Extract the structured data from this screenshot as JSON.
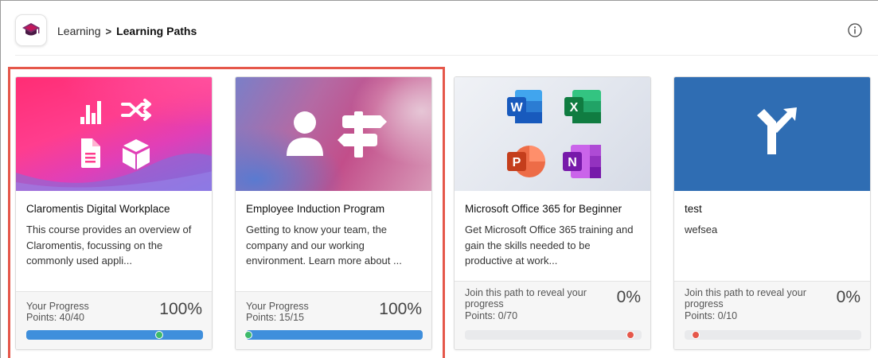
{
  "header": {
    "breadcrumb_root": "Learning",
    "breadcrumb_separator": ">",
    "breadcrumb_current": "Learning Paths",
    "info_icon": "info-icon",
    "logo_icon": "graduation-cap-icon"
  },
  "colors": {
    "accent": "#3f8fdc",
    "highlight_border": "#e5574a",
    "progress_dot_complete": "#3dba6a",
    "progress_dot_none": "#e5574a"
  },
  "cards": [
    {
      "title": "Claromentis Digital Workplace",
      "description": "This course provides an overview of Claromentis, focussing on the commonly used appli...",
      "progress_label": "Your Progress",
      "points": "Points: 40/40",
      "percent": "100%",
      "progress_fraction": 1.0,
      "icons": [
        "bar-chart-icon",
        "shuffle-icon",
        "document-icon",
        "cube-icon"
      ]
    },
    {
      "title": "Employee Induction Program",
      "description": "Getting to know your team, the company and our working environment. Learn more about ...",
      "progress_label": "Your Progress",
      "points": "Points: 15/15",
      "percent": "100%",
      "progress_fraction": 1.0,
      "icons": [
        "person-icon",
        "signpost-icon"
      ]
    },
    {
      "title": "Microsoft Office 365 for Beginner",
      "description": "Get Microsoft Office 365 training and gain the skills needed to be productive at work...",
      "progress_label": "Join this path to reveal your progress",
      "points": "Points: 0/70",
      "percent": "0%",
      "progress_fraction": 0.0,
      "icons": [
        "word-icon",
        "excel-icon",
        "powerpoint-icon",
        "onenote-icon"
      ],
      "app_letters": [
        "W",
        "X",
        "P",
        "N"
      ]
    },
    {
      "title": "test",
      "description": "wefsea",
      "progress_label": "Join this path to reveal your progress",
      "points": "Points: 0/10",
      "percent": "0%",
      "progress_fraction": 0.0,
      "icons": [
        "fork-arrow-icon"
      ]
    }
  ]
}
